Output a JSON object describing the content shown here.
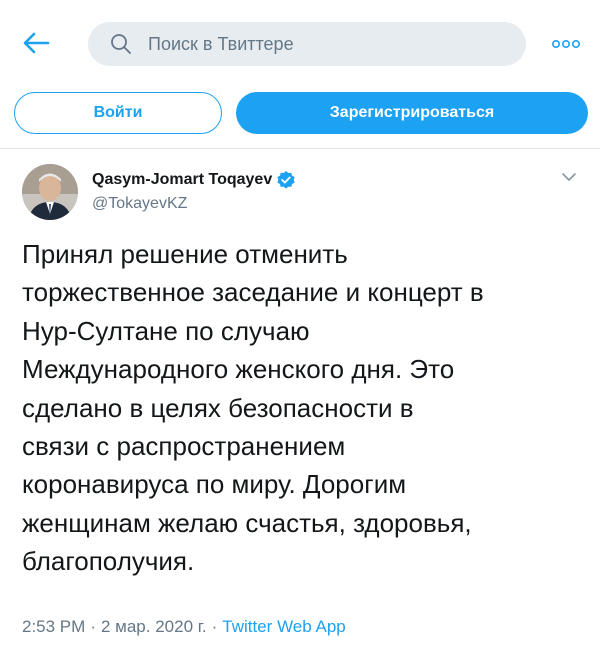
{
  "colors": {
    "accent": "#1da1f2",
    "text_primary": "#14171a",
    "text_secondary": "#657786",
    "search_bg": "#e6ecf0"
  },
  "header": {
    "back_icon": "arrow-left-icon",
    "search": {
      "placeholder": "Поиск в Твиттере",
      "icon": "search-icon"
    },
    "more_icon": "more-dots-icon"
  },
  "auth": {
    "login_label": "Войти",
    "signup_label": "Зарегистрироваться"
  },
  "tweet": {
    "author": {
      "name": "Qasym-Jomart Toqayev",
      "handle": "@TokayevKZ",
      "verified": true
    },
    "text": "Принял решение отменить\nторжественное заседание и концерт в\nНур-Султане по случаю\nМеждународного женского дня. Это\nсделано в целях безопасности в\nсвязи с распространением\nкоронавируса по миру. Дорогим\nженщинам желаю счастья, здоровья,\nблагополучия.",
    "time": "2:53 PM",
    "date": "2 мар. 2020 г.",
    "separator": "·",
    "source": "Twitter Web App"
  }
}
